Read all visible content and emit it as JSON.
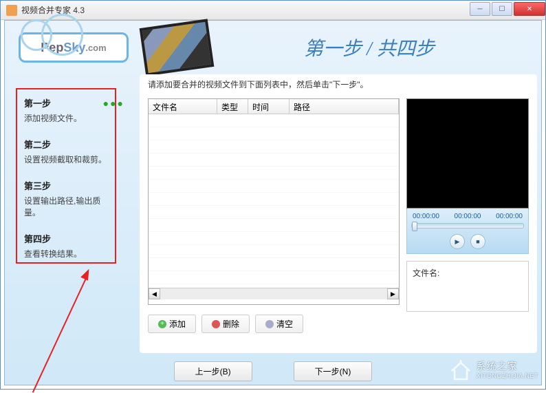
{
  "window": {
    "title": "视频合并专家 4.3"
  },
  "header": {
    "logo": {
      "pep": "Pep",
      "sky": "Sky",
      "com": ".com"
    },
    "step_banner": "第一步 / 共四步"
  },
  "sidebar": {
    "steps": [
      {
        "title": "第一步",
        "desc": "添加视频文件。"
      },
      {
        "title": "第二步",
        "desc": "设置视频截取和裁剪。"
      },
      {
        "title": "第三步",
        "desc": "设置输出路径,输出质量。"
      },
      {
        "title": "第四步",
        "desc": "查看转换结果。"
      }
    ],
    "dots": "●●●"
  },
  "main": {
    "instruction": "请添加要合并的视频文件到下面列表中，然后单击\"下一步\"。",
    "table": {
      "columns": [
        "文件名",
        "类型",
        "时间",
        "路径"
      ]
    },
    "preview": {
      "times": [
        "00:00:00",
        "00:00:00",
        "00:00:00"
      ],
      "play_glyph": "▶",
      "stop_glyph": "■",
      "filename_label": "文件名:"
    },
    "actions": {
      "add": "添加",
      "delete": "删除",
      "clear": "清空",
      "add_glyph": "+",
      "del_glyph": "✕"
    }
  },
  "footer": {
    "prev": "上一步(B)",
    "next": "下一步(N)"
  },
  "watermark": {
    "brand": "系统之家",
    "url": "XITONGZHIJIA.NET"
  }
}
